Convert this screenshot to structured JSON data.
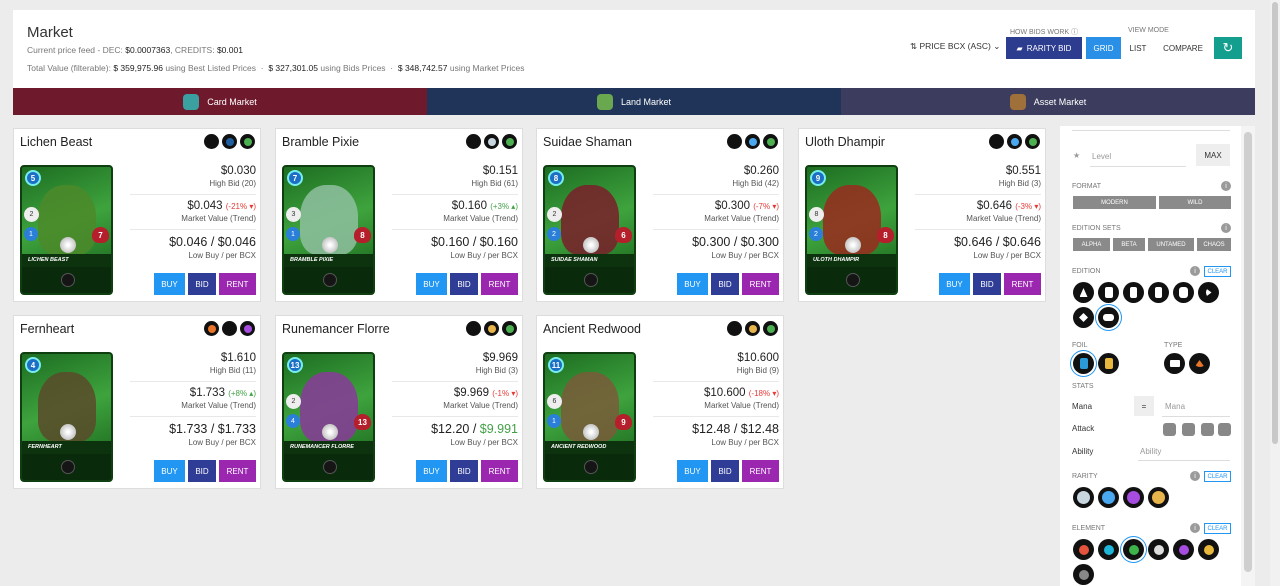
{
  "header": {
    "title": "Market",
    "feed_label": "Current price feed - DEC: ",
    "dec_price": "$0.0007363",
    "credits_label": ", CREDITS: ",
    "credits_price": "$0.001",
    "totals_label": "Total Value (filterable): ",
    "best_listed": "$ 359,975.96",
    "best_listed_label": " using Best Listed Prices",
    "bids": "$ 327,301.05",
    "bids_label": " using Bids Prices",
    "market": "$ 348,742.57",
    "market_label": " using Market Prices",
    "dot": "·",
    "how_bids_work": "HOW BIDS WORK",
    "view_mode": "VIEW MODE",
    "sort_label": "PRICE BCX (ASC)",
    "rarity_bid": "RARITY BID",
    "grid": "GRID",
    "list": "LIST",
    "compare": "COMPARE",
    "refresh_glyph": "↻"
  },
  "tabs": [
    {
      "label": "Card Market",
      "color": "#6e1a2c"
    },
    {
      "label": "Land Market",
      "color": "#1f3458"
    },
    {
      "label": "Asset Market",
      "color": "#3c3c5e"
    }
  ],
  "card_labels": {
    "high_bid": "High Bid",
    "market_value": "Market Value (Trend)",
    "low_buy": "Low Buy / per BCX",
    "buy": "BUY",
    "bid": "BID",
    "rent": "RENT"
  },
  "cards": [
    {
      "name": "Lichen Beast",
      "price": "$0.030",
      "high_bid": "High Bid (20)",
      "market": "$0.043",
      "trend": "(-21% ▾)",
      "low_buy": "$0.046 / $0.046",
      "low_buy_a": "$0.046 / $0.046",
      "low_buy_b": "",
      "mana": "5",
      "hp": "7",
      "atk": "2",
      "spd": "1",
      "art_name": "LICHEN BEAST",
      "figure_color": "#4c8a2a"
    },
    {
      "name": "Bramble Pixie",
      "price": "$0.151",
      "high_bid": "High Bid (61)",
      "market": "$0.160",
      "trend": "(+3% ▴)",
      "low_buy_a": "$0.160 / $0.160",
      "low_buy_b": "",
      "mana": "7",
      "hp": "8",
      "atk": "3",
      "spd": "1",
      "art_name": "BRAMBLE PIXIE",
      "figure_color": "#8fc0a0"
    },
    {
      "name": "Suidae Shaman",
      "price": "$0.260",
      "high_bid": "High Bid (42)",
      "market": "$0.300",
      "trend": "(-7% ▾)",
      "low_buy_a": "$0.300 / $0.300",
      "low_buy_b": "",
      "mana": "8",
      "hp": "6",
      "atk": "2",
      "spd": "2",
      "art_name": "SUIDAE SHAMAN",
      "figure_color": "#7a1f2a"
    },
    {
      "name": "Uloth Dhampir",
      "price": "$0.551",
      "high_bid": "High Bid (3)",
      "market": "$0.646",
      "trend": "(-3% ▾)",
      "low_buy_a": "$0.646 / $0.646",
      "low_buy_b": "",
      "mana": "9",
      "hp": "8",
      "atk": "8",
      "spd": "2",
      "art_name": "ULOTH DHAMPIR",
      "figure_color": "#9a2a1e"
    },
    {
      "name": "Fernheart",
      "price": "$1.610",
      "high_bid": "High Bid (11)",
      "market": "$1.733",
      "trend": "(+8% ▴)",
      "low_buy_a": "$1.733 / $1.733",
      "low_buy_b": "",
      "mana": "4",
      "hp": "",
      "atk": "",
      "spd": "",
      "art_name": "FERNHEART",
      "figure_color": "#5a4a2a"
    },
    {
      "name": "Runemancer Florre",
      "price": "$9.969",
      "high_bid": "High Bid (3)",
      "market": "$9.969",
      "trend": "(-1% ▾)",
      "low_buy_a": "$12.20 / ",
      "low_buy_b": "$9.991",
      "mana": "13",
      "hp": "13",
      "atk": "2",
      "spd": "4",
      "art_name": "RUNEMANCER FLORRE",
      "figure_color": "#8a3a9a"
    },
    {
      "name": "Ancient Redwood",
      "price": "$10.600",
      "high_bid": "High Bid (9)",
      "market": "$10.600",
      "trend": "(-18% ▾)",
      "low_buy_a": "$12.48 / $12.48",
      "low_buy_b": "",
      "mana": "11",
      "hp": "9",
      "atk": "6",
      "spd": "1",
      "art_name": "ANCIENT REDWOOD",
      "figure_color": "#7a5a3a"
    }
  ],
  "filters": {
    "level_placeholder": "Level",
    "max": "MAX",
    "format": "FORMAT",
    "modern": "MODERN",
    "wild": "WILD",
    "edition_sets": "EDITION SETS",
    "sets": [
      "ALPHA",
      "BETA",
      "UNTAMED",
      "CHAOS"
    ],
    "edition": "EDITION",
    "clear": "CLEAR",
    "foil": "FOIL",
    "type": "TYPE",
    "stats": "STATS",
    "mana": "Mana",
    "mana_op": "=",
    "mana_placeholder": "Mana",
    "attack": "Attack",
    "ability": "Ability",
    "ability_placeholder": "Ability",
    "rarity": "RARITY",
    "rarity_colors": [
      "#c8d6e0",
      "#4aa8f0",
      "#a64ce0",
      "#e8b44c"
    ],
    "element": "ELEMENT",
    "element_colors": [
      "#e5533c",
      "#1fb5d9",
      "#3db34a",
      "#dddddd",
      "#a64ce0",
      "#e8b83c",
      "#888888"
    ],
    "star_glyph": "★",
    "info_glyph": "i"
  }
}
